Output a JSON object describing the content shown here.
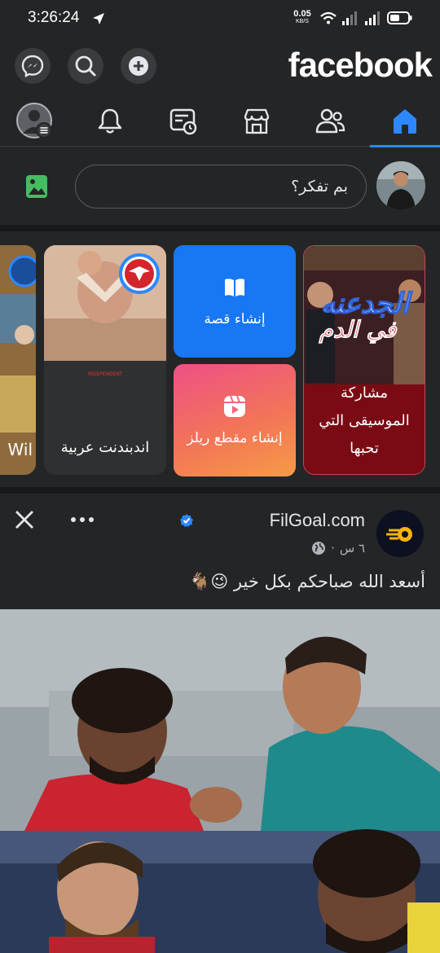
{
  "status_bar": {
    "time": "3:26:24",
    "net_speed_value": "0.05",
    "net_speed_unit": "KB/S",
    "battery_icon": "battery-icon",
    "wifi_icon": "wifi-icon"
  },
  "header": {
    "logo": "facebook",
    "buttons": [
      "messenger-icon",
      "search-icon",
      "plus-icon"
    ]
  },
  "tabs": [
    {
      "name": "menu",
      "icon": "profile-menu-icon"
    },
    {
      "name": "notifications",
      "icon": "bell-icon"
    },
    {
      "name": "memories",
      "icon": "memories-icon"
    },
    {
      "name": "marketplace",
      "icon": "marketplace-icon"
    },
    {
      "name": "friends",
      "icon": "friends-icon"
    },
    {
      "name": "home",
      "icon": "home-icon",
      "active": true
    }
  ],
  "composer": {
    "placeholder": "بم تفكر؟"
  },
  "stories": {
    "music_card_label": "مشاركة الموسيقى التي تحبها",
    "create_story_label": "إنشاء قصة",
    "create_reel_label": "إنشاء مقطع ريلز",
    "story_independent_label": "اندبندنت عربية",
    "story_partial_label": "Wil"
  },
  "post": {
    "page_name": "FilGoal.com",
    "time": "٦ س",
    "separator": "·",
    "text": "أسعد الله صباحكم بكل خير 😉🐐"
  },
  "colors": {
    "background": "#242526",
    "accent": "#2d88ff",
    "create_story_bg": "#1877f2",
    "music_card_bg": "#7a0b14"
  }
}
